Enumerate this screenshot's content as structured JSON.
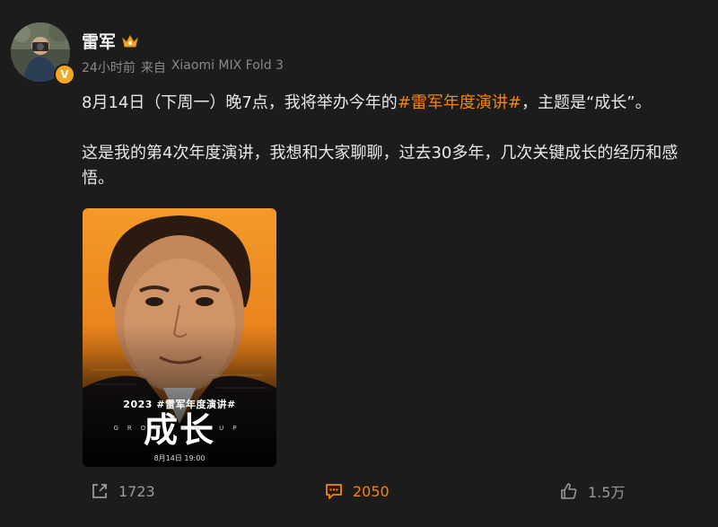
{
  "author": {
    "name": "雷军",
    "verified": true,
    "badge_color": "#f5a623"
  },
  "meta": {
    "time": "24小时前",
    "source_prefix": "来自",
    "device": "Xiaomi MIX Fold 3"
  },
  "content": {
    "p1_before": "8月14日（下周一）晚7点，我将举办今年的",
    "p1_hashtag": "#雷军年度演讲#",
    "p1_after": "，主题是“成长”。",
    "p2": "这是我的第4次年度演讲，我想和大家聊聊，过去30多年，几次关键成长的经历和感悟。"
  },
  "poster": {
    "year_line": "2023 #雷军年度演讲#",
    "title": "成长",
    "subtitle": "GROWING UP",
    "date": "8月14日 19:00",
    "bg_color": "#f08a1c"
  },
  "actions": {
    "repost_count": "1723",
    "comment_count": "2050",
    "like_count": "1.5万",
    "accent_color": "#ff8200"
  }
}
